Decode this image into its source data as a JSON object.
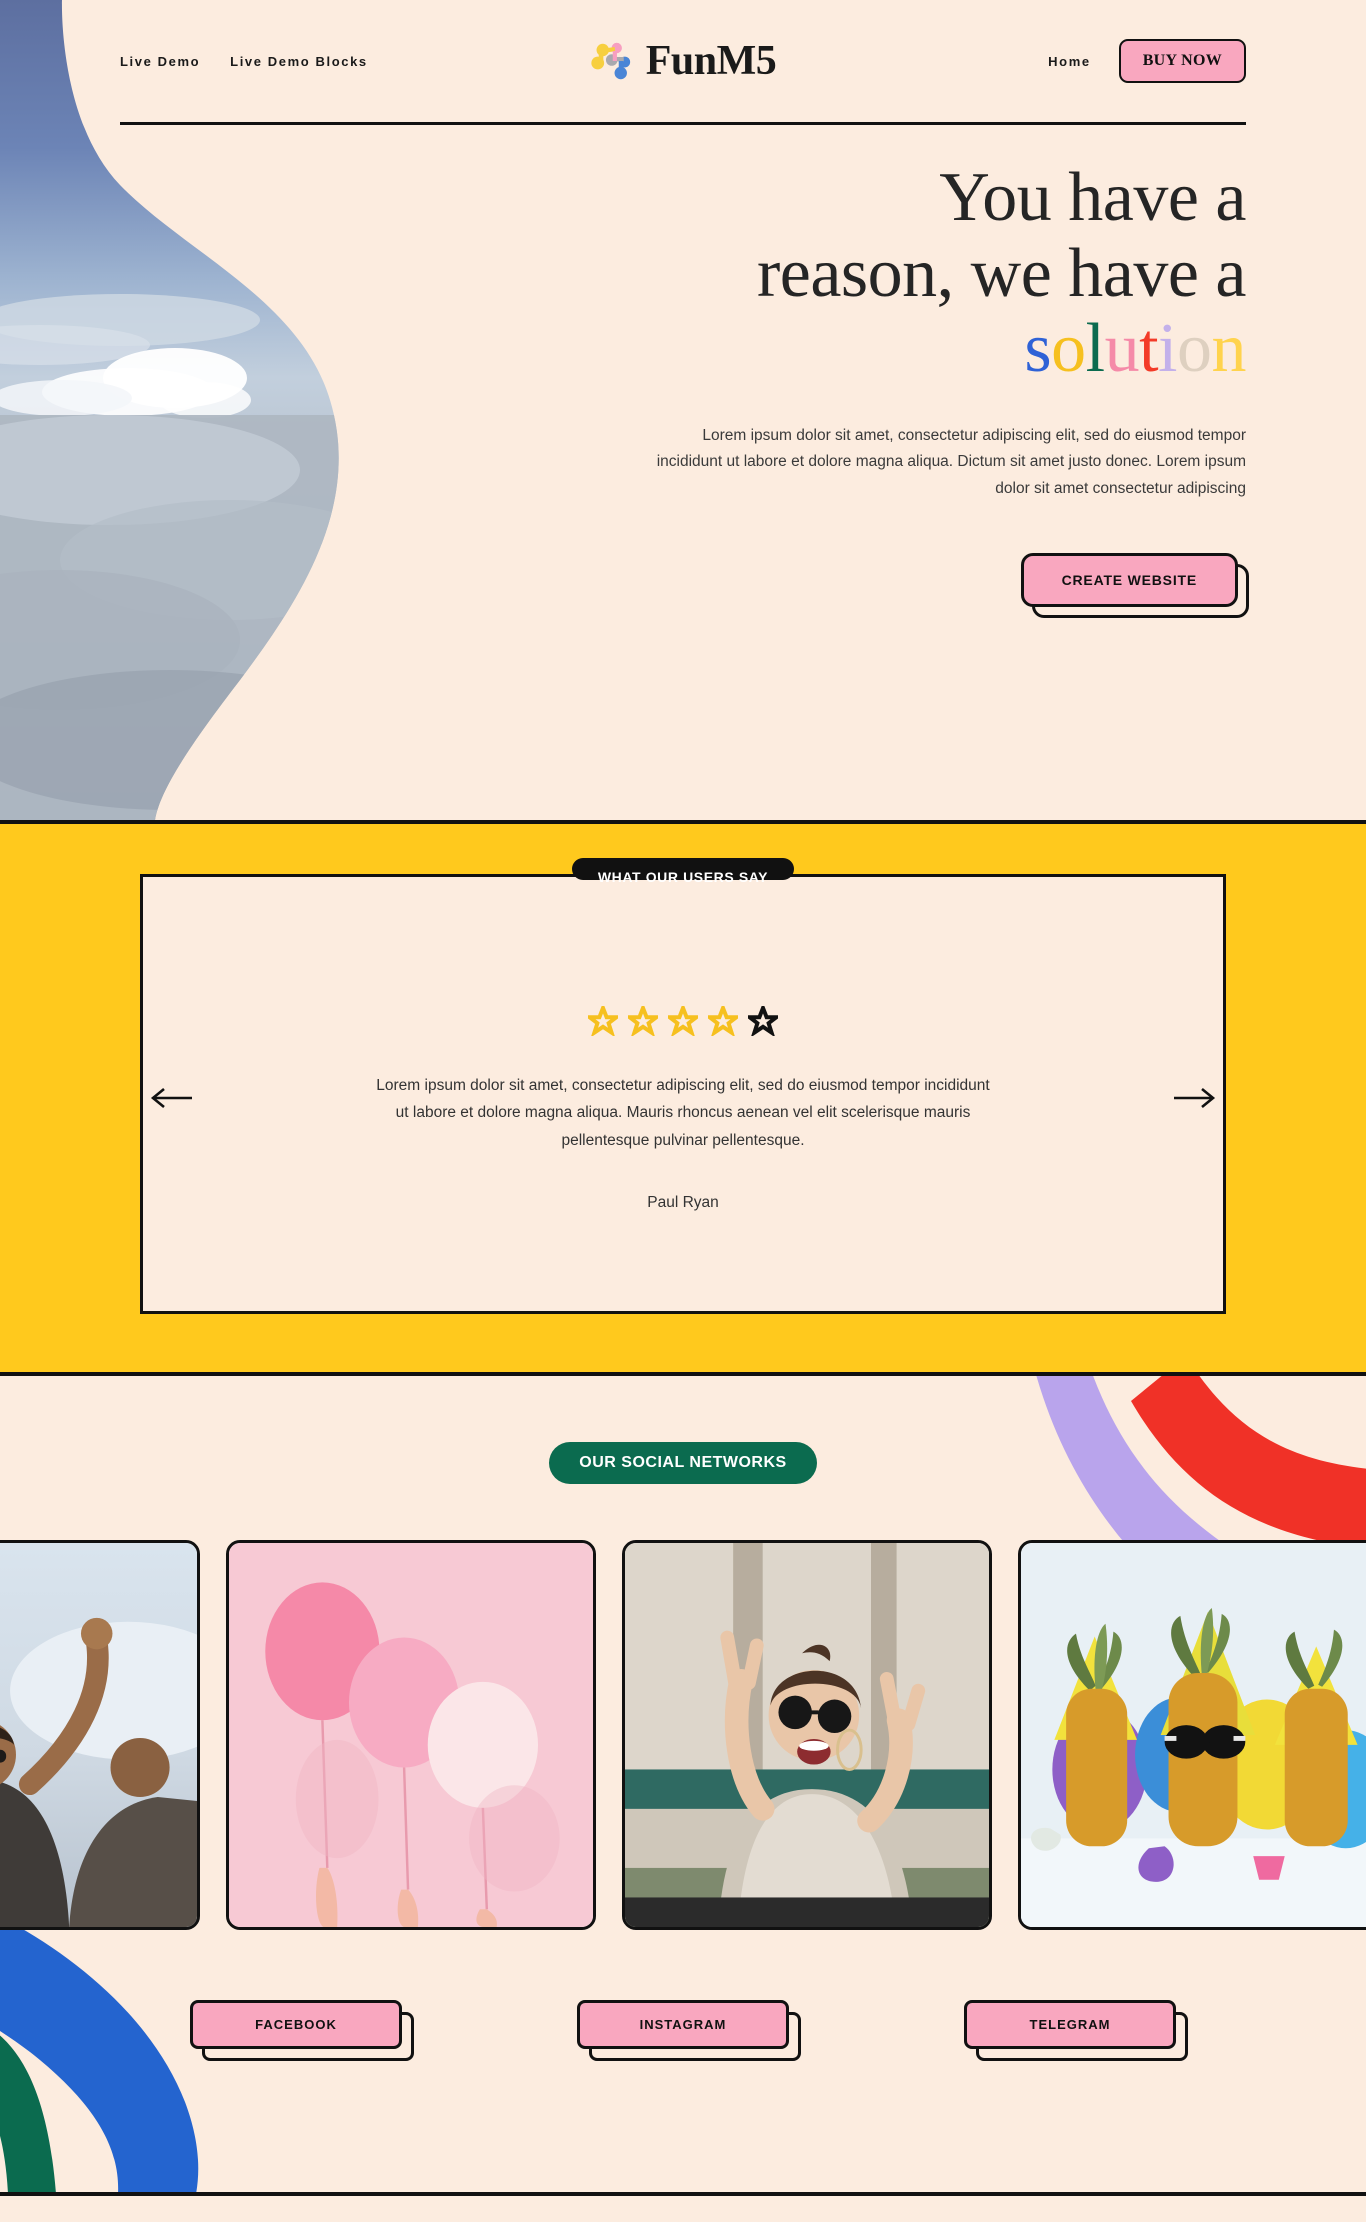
{
  "colors": {
    "cream": "#fcecdf",
    "pink": "#f9a7bf",
    "yellow": "#ffc91d",
    "green": "#0b6b4f",
    "black": "#111111",
    "blue_letter": "#2f62d6",
    "gold_letter": "#f6c01f",
    "green_letter": "#0b6b4f",
    "pink_letter": "#f58aa8",
    "red_letter": "#f33b28",
    "lavender_letter": "#c3b0ea",
    "tan_letter": "#ded0c0",
    "yellow_letter": "#ffd34d",
    "ribbon_purple": "#b9a4ec",
    "ribbon_red": "#f03127",
    "ribbon_blue": "#2464cf",
    "ribbon_green": "#0b6b4f"
  },
  "header": {
    "nav_links": [
      {
        "label": "Live Demo",
        "name": "nav-live-demo"
      },
      {
        "label": "Live Demo Blocks",
        "name": "nav-live-demo-blocks"
      }
    ],
    "brand_name": "FunM5",
    "brand_icon": "molecule-icon",
    "home_label": "Home",
    "buy_label": "BUY NOW"
  },
  "hero": {
    "title_line1": "You have a",
    "title_line2": "reason, we have a",
    "title_colored_word": "solution",
    "colored_letters": [
      {
        "char": "s",
        "color": "#2f62d6"
      },
      {
        "char": "o",
        "color": "#f6c01f"
      },
      {
        "char": "l",
        "color": "#0b6b4f"
      },
      {
        "char": "u",
        "color": "#f58aa8"
      },
      {
        "char": "t",
        "color": "#f33b28"
      },
      {
        "char": "i",
        "color": "#c3b0ea"
      },
      {
        "char": "o",
        "color": "#ded0c0"
      },
      {
        "char": "n",
        "color": "#ffd34d"
      }
    ],
    "paragraph": "Lorem ipsum dolor sit amet, consectetur adipiscing elit, sed do eiusmod tempor incididunt ut labore et dolore magna aliqua. Dictum sit amet justo donec. Lorem ipsum dolor sit amet consectetur adipiscing",
    "cta_label": "CREATE WEBSITE",
    "image_alt": "clouds-sky-photo"
  },
  "testimonial": {
    "badge": "WHAT OUR USERS SAY",
    "rating_filled": 4,
    "rating_total": 5,
    "quote": "Lorem ipsum dolor sit amet, consectetur adipiscing elit, sed do eiusmod tempor incididunt ut labore et dolore magna aliqua. Mauris rhoncus aenean vel elit scelerisque mauris pellentesque pulvinar pellentesque.",
    "author": "Paul Ryan",
    "prev_label": "previous-testimonial",
    "next_label": "next-testimonial"
  },
  "social": {
    "badge": "OUR SOCIAL NETWORKS",
    "gallery": [
      {
        "alt": "friends-celebrating-photo"
      },
      {
        "alt": "pink-balloons-photo"
      },
      {
        "alt": "woman-peace-signs-photo"
      },
      {
        "alt": "party-pineapples-photo"
      }
    ],
    "buttons": [
      {
        "label": "FACEBOOK",
        "name": "facebook-button"
      },
      {
        "label": "INSTAGRAM",
        "name": "instagram-button"
      },
      {
        "label": "TELEGRAM",
        "name": "telegram-button"
      }
    ]
  }
}
